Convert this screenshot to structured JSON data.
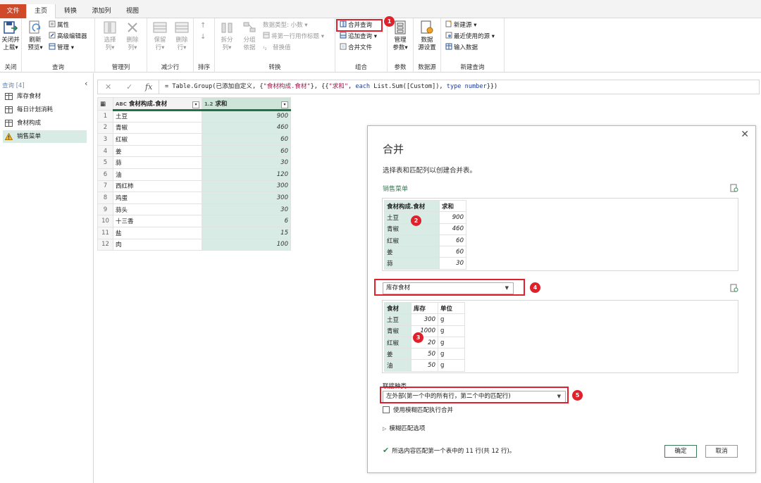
{
  "tabs": [
    "文件",
    "主页",
    "转换",
    "添加列",
    "视图"
  ],
  "ribbon": {
    "close": {
      "label1": "关闭并",
      "label2": "上载",
      "group": "关闭"
    },
    "query": {
      "refresh1": "刷新",
      "refresh2": "预览",
      "properties": "属性",
      "advanced_editor": "高级编辑器",
      "manage": "管理",
      "group": "查询"
    },
    "manage_cols": {
      "choose1": "选择",
      "choose2": "列",
      "remove1": "删除",
      "remove2": "列",
      "group": "管理列"
    },
    "reduce_rows": {
      "keep1": "保留",
      "keep2": "行",
      "remove1": "删除",
      "remove2": "行",
      "group": "减少行"
    },
    "sort": {
      "group": "排序"
    },
    "transform": {
      "split1": "拆分",
      "split2": "列",
      "groupby1": "分组",
      "groupby2": "依据",
      "datatype": "数据类型: 小数",
      "firstrow": "将第一行用作标题",
      "replace": "替换值",
      "group": "转换"
    },
    "combine": {
      "merge": "合并查询",
      "append": "追加查询",
      "combine_files": "合并文件",
      "group": "组合"
    },
    "params": {
      "manage1": "管理",
      "manage2": "参数",
      "group": "参数"
    },
    "datasource": {
      "settings1": "数据",
      "settings2": "源设置",
      "group": "数据源"
    },
    "newquery": {
      "new_source": "新建源",
      "recent": "最近使用的源",
      "enter_data": "输入数据",
      "group": "新建查询"
    }
  },
  "queries": {
    "header": "查询 [4]",
    "items": [
      "库存食材",
      "每日计划消耗",
      "食材构成",
      "销售菜单"
    ]
  },
  "formula": {
    "prefix": "= Table.Group(已添加自定义, {",
    "str1": "\"食材构成.食材\"",
    "mid1": "}, {{",
    "str2": "\"求和\"",
    "mid2": ", ",
    "kw1": "each",
    "mid3": " List.Sum([Custom]), ",
    "kw2": "type",
    "mid4": " ",
    "kw3": "number",
    "suffix": "}})"
  },
  "grid": {
    "col1": "食材构成.食材",
    "col1_type": "ABC",
    "col2": "求和",
    "col2_type": "1.2",
    "rows": [
      {
        "n": "1",
        "name": "土豆",
        "val": "900"
      },
      {
        "n": "2",
        "name": "青椒",
        "val": "460"
      },
      {
        "n": "3",
        "name": "红椒",
        "val": "60"
      },
      {
        "n": "4",
        "name": "姜",
        "val": "60"
      },
      {
        "n": "5",
        "name": "蒜",
        "val": "30"
      },
      {
        "n": "6",
        "name": "油",
        "val": "120"
      },
      {
        "n": "7",
        "name": "西红柿",
        "val": "300"
      },
      {
        "n": "8",
        "name": "鸡蛋",
        "val": "300"
      },
      {
        "n": "9",
        "name": "蒜头",
        "val": "30"
      },
      {
        "n": "10",
        "name": "十三香",
        "val": "6"
      },
      {
        "n": "11",
        "name": "盐",
        "val": "15"
      },
      {
        "n": "12",
        "name": "肉",
        "val": "100"
      }
    ]
  },
  "dialog": {
    "title": "合并",
    "subtitle": "选择表和匹配列以创建合并表。",
    "table1_name": "销售菜单",
    "table1": {
      "headers": [
        "食材构成.食材",
        "求和"
      ],
      "rows": [
        [
          "土豆",
          "900"
        ],
        [
          "青椒",
          "460"
        ],
        [
          "红椒",
          "60"
        ],
        [
          "姜",
          "60"
        ],
        [
          "蒜",
          "30"
        ]
      ]
    },
    "table2_select": "库存食材",
    "table2": {
      "headers": [
        "食材",
        "库存",
        "单位"
      ],
      "rows": [
        [
          "土豆",
          "300",
          "g"
        ],
        [
          "青椒",
          "1000",
          "g"
        ],
        [
          "红椒",
          "20",
          "g"
        ],
        [
          "姜",
          "50",
          "g"
        ],
        [
          "油",
          "50",
          "g"
        ]
      ]
    },
    "join_label": "联接种类",
    "join_value": "左外部(第一个中的所有行，第二个中的匹配行)",
    "fuzzy_checkbox": "使用模糊匹配执行合并",
    "fuzzy_options": "模糊匹配选项",
    "status": "所选内容匹配第一个表中的 11 行(共 12 行)。",
    "ok": "确定",
    "cancel": "取消"
  },
  "callouts": [
    "1",
    "2",
    "3",
    "4",
    "5"
  ],
  "colors": {
    "accent": "#217346",
    "file_tab": "#d04a2a",
    "annotation": "#e0202a",
    "selected_col": "#d8ebe4"
  }
}
